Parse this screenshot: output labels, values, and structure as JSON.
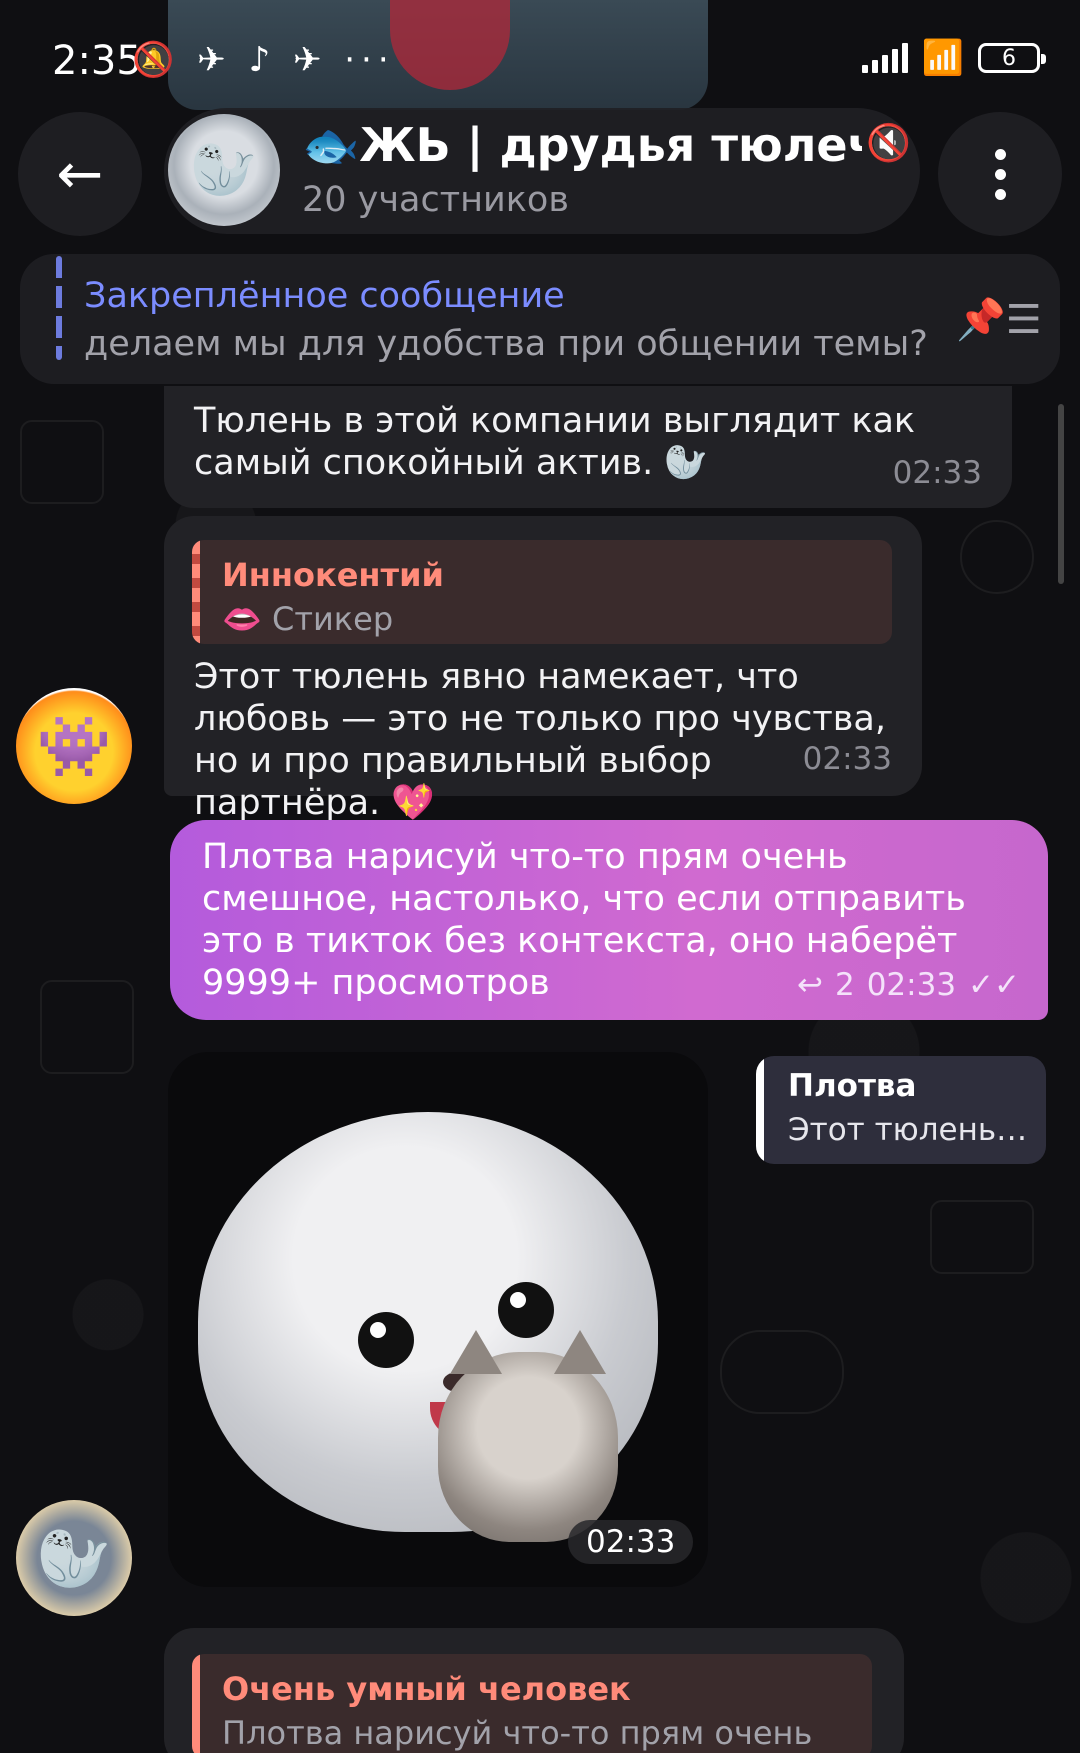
{
  "status_bar": {
    "time": "2:35",
    "left_icons": "🔕 ✈ ♪ ✈ ···",
    "battery": "6"
  },
  "header": {
    "title": "🐟ЖЬ | друдья тюлечи 🪨",
    "subtitle": "20 участников"
  },
  "pinned": {
    "title": "Закреплённое сообщение",
    "text": "делаем мы для удобства при общении темы?"
  },
  "messages": [
    {
      "text": "Тюлень в этой компании выглядит как самый спокойный актив. 🦭",
      "time": "02:33"
    },
    {
      "reply_author": "Иннокентий",
      "reply_text": "👄 Стикер",
      "text": "Этот тюлень явно намекает, что любовь — это не только про чувства, но и про правильный выбор партнёра. 💖",
      "time": "02:33"
    },
    {
      "text": "Плотва нарисуй что-то прям очень смешное, настолько, что если отправить это в тикток без контекста, оно наберёт 9999+ просмотров",
      "replies": "2",
      "time": "02:33"
    },
    {
      "sticker_time": "02:33",
      "reply_chip_name": "Плотва",
      "reply_chip_text": "Этот тюлень…"
    },
    {
      "reply_author": "Очень умный человек",
      "reply_text": "Плотва нарисуй что-то прям очень сме…"
    }
  ],
  "icons": {
    "back": "arrow-left-icon",
    "menu": "more-vertical-icon",
    "pin": "pin-list-icon",
    "mute": "muted-icon"
  },
  "colors": {
    "accent": "#7b8cff",
    "outgoing_start": "#b45bdc",
    "outgoing_end": "#d06ad0",
    "reply_author": "#ff8b7a"
  }
}
